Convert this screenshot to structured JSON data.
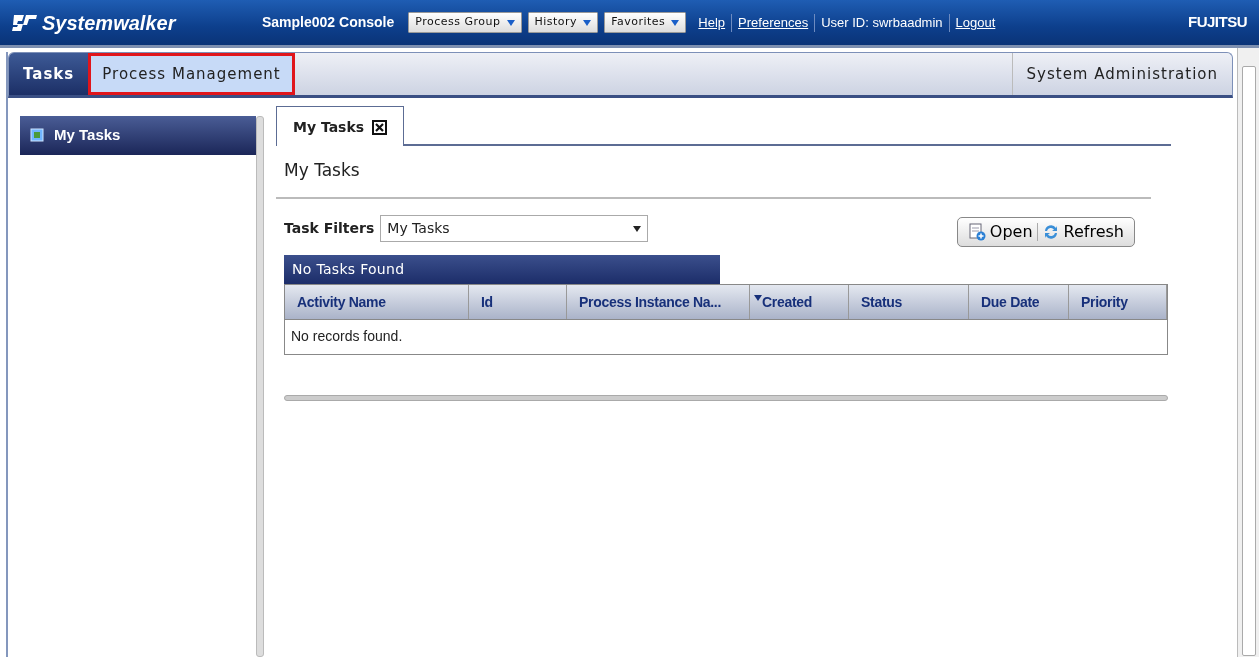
{
  "header": {
    "logo": "Systemwalker",
    "console_title": "Sample002 Console",
    "menus": [
      {
        "label": "Process Group",
        "kind": "dropdown"
      },
      {
        "label": "History",
        "kind": "dropdown"
      },
      {
        "label": "Favorites",
        "kind": "dropdown"
      },
      {
        "label": "Help",
        "kind": "link"
      },
      {
        "label": "Preferences",
        "kind": "link"
      },
      {
        "label": "User ID: swrbaadmin",
        "kind": "text"
      },
      {
        "label": "Logout",
        "kind": "link"
      }
    ],
    "brand": "FUJITSU"
  },
  "main_tabs": [
    {
      "label": "Tasks",
      "selected": true,
      "highlighted": false
    },
    {
      "label": "Process Management",
      "selected": false,
      "highlighted": true
    }
  ],
  "right_tabs": [
    {
      "label": "System Administration",
      "selected": false,
      "highlighted": false
    }
  ],
  "sidebar": {
    "items": [
      {
        "label": "My Tasks",
        "selected": true
      }
    ]
  },
  "content_tabs": [
    {
      "label": "My Tasks",
      "selected": true,
      "closable": true
    }
  ],
  "page_title": "My Tasks",
  "filter": {
    "label": "Task Filters",
    "value": "My Tasks"
  },
  "toolbar": [
    {
      "label": "Open",
      "kind": "open"
    },
    {
      "label": "Refresh",
      "kind": "refresh"
    }
  ],
  "table": {
    "caption": "No Tasks Found",
    "columns": [
      {
        "label": "Activity Name",
        "sorted": false
      },
      {
        "label": "Id",
        "sorted": false
      },
      {
        "label": "Process Instance Na...",
        "sorted": false
      },
      {
        "label": "Created",
        "sorted": true
      },
      {
        "label": "Status",
        "sorted": false
      },
      {
        "label": "Due Date",
        "sorted": false
      },
      {
        "label": "Priority",
        "sorted": false
      }
    ],
    "empty_text": "No records found."
  }
}
